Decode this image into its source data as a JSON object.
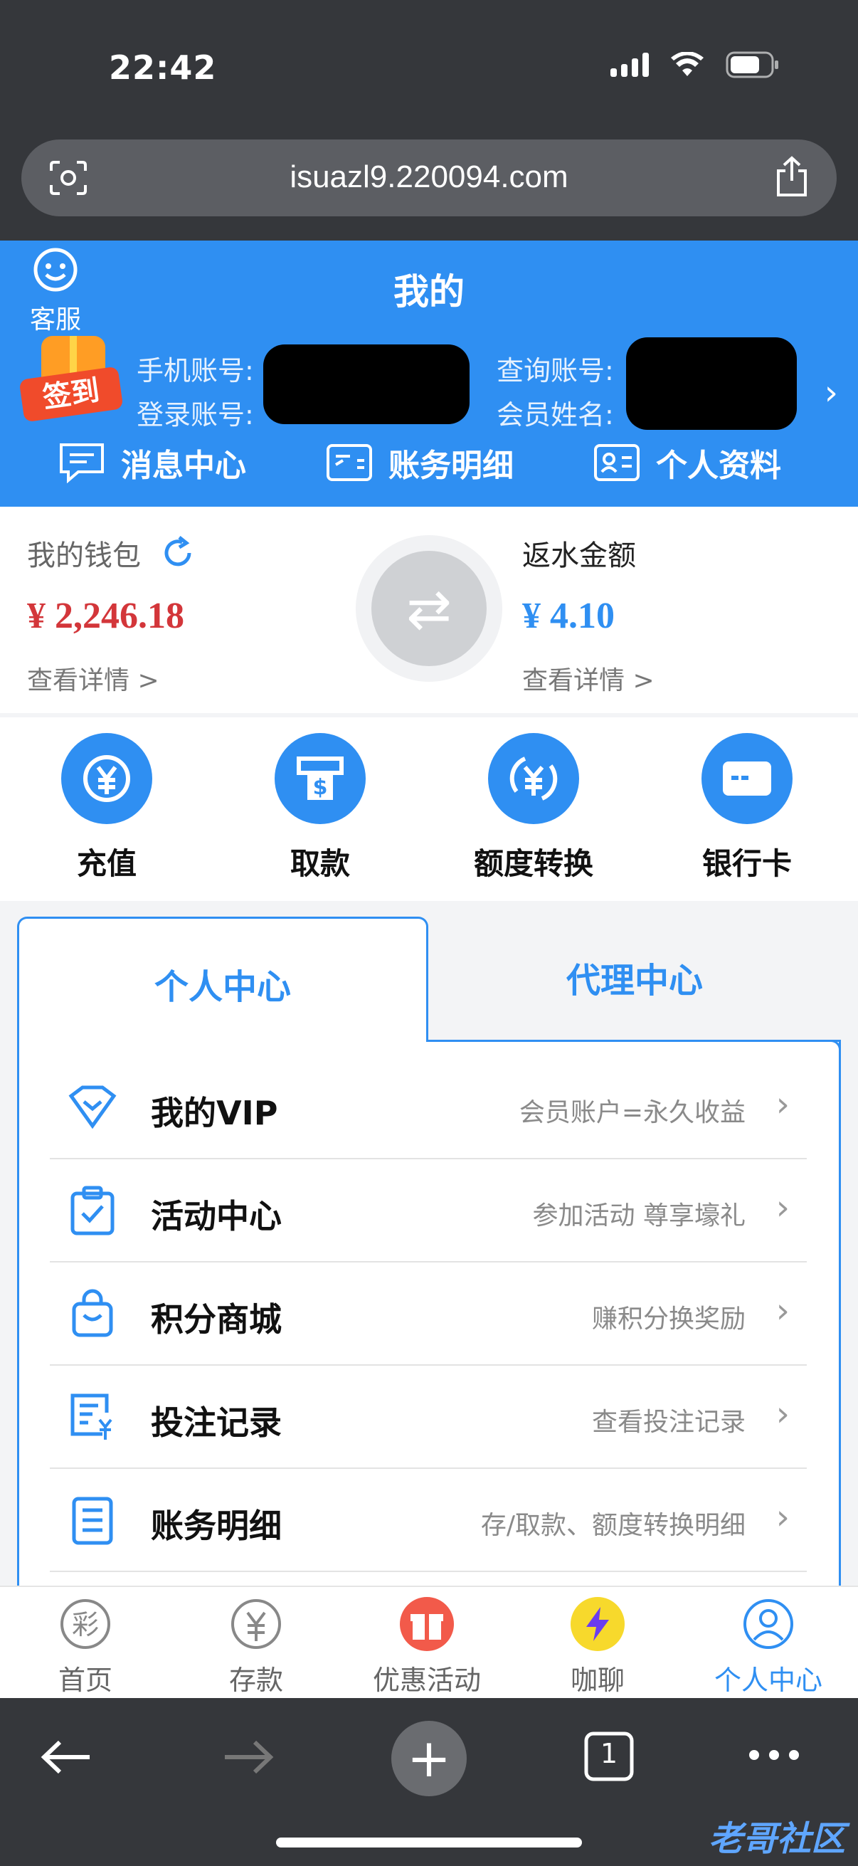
{
  "status_bar": {
    "time": "22:42"
  },
  "browser": {
    "url": "isuazl9.220094.com"
  },
  "header": {
    "customer_service_label": "客服",
    "title": "我的",
    "sign_in_badge": "签到",
    "phone_account_label": "手机账号:",
    "login_account_label": "登录账号:",
    "query_account_label": "查询账号:",
    "member_name_label": "会员姓名:",
    "quick_links": [
      "消息中心",
      "账务明细",
      "个人资料"
    ]
  },
  "wallet": {
    "title": "我的钱包",
    "amount": "¥ 2,246.18",
    "detail_link": "查看详情 >",
    "rebate_title": "返水金额",
    "rebate_amount": "¥ 4.10",
    "rebate_detail_link": "查看详情 >"
  },
  "services": [
    "充值",
    "取款",
    "额度转换",
    "银行卡"
  ],
  "tabs": {
    "personal": "个人中心",
    "agent": "代理中心"
  },
  "menu": [
    {
      "title": "我的VIP",
      "desc": "会员账户=永久收益",
      "icon": "heart-badge-icon"
    },
    {
      "title": "活动中心",
      "desc": "参加活动 尊享壕礼",
      "icon": "clipboard-check-icon"
    },
    {
      "title": "积分商城",
      "desc": "赚积分换奖励",
      "icon": "shopping-bag-icon"
    },
    {
      "title": "投注记录",
      "desc": "查看投注记录",
      "icon": "bet-record-icon"
    },
    {
      "title": "账务明细",
      "desc": "存/取款、额度转换明细",
      "icon": "ledger-icon"
    }
  ],
  "tabbar": [
    "首页",
    "存款",
    "优惠活动",
    "咖聊",
    "个人中心"
  ],
  "browser_bottom": {
    "tab_count": "1"
  },
  "watermark": "老哥社区",
  "colors": {
    "primary": "#2f8ff2",
    "amount_red": "#d3363a",
    "browser_dark": "#35373b"
  }
}
